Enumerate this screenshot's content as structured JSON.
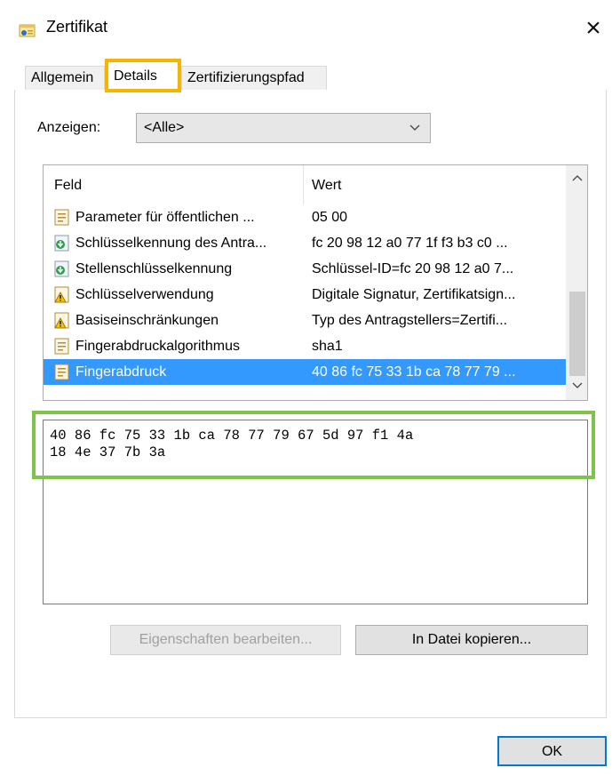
{
  "window": {
    "title": "Zertifikat",
    "close_glyph": "×"
  },
  "tabs": [
    {
      "label": "Allgemein",
      "active": false
    },
    {
      "label": "Details",
      "active": true
    },
    {
      "label": "Zertifizierungspfad",
      "active": false
    }
  ],
  "show": {
    "label": "Anzeigen:",
    "value": "<Alle>"
  },
  "list": {
    "columns": [
      "Feld",
      "Wert"
    ],
    "rows": [
      {
        "icon": "document-icon",
        "feld": "Parameter für öffentlichen ...",
        "wert": "05 00",
        "selected": false
      },
      {
        "icon": "key-download-icon",
        "feld": "Schlüsselkennung des Antra...",
        "wert": "fc 20 98 12 a0 77 1f f3 b3 c0 ...",
        "selected": false
      },
      {
        "icon": "key-download-icon",
        "feld": "Stellenschlüsselkennung",
        "wert": "Schlüssel-ID=fc 20 98 12 a0 7...",
        "selected": false
      },
      {
        "icon": "warning-document-icon",
        "feld": "Schlüsselverwendung",
        "wert": "Digitale Signatur, Zertifikatsign...",
        "selected": false
      },
      {
        "icon": "warning-document-icon",
        "feld": "Basiseinschränkungen",
        "wert": "Typ des Antragstellers=Zertifi...",
        "selected": false
      },
      {
        "icon": "document-icon",
        "feld": "Fingerabdruckalgorithmus",
        "wert": "sha1",
        "selected": false
      },
      {
        "icon": "document-icon",
        "feld": "Fingerabdruck",
        "wert": "40 86 fc 75 33 1b ca 78 77 79 ...",
        "selected": true
      }
    ]
  },
  "detail": {
    "line1": "40 86 fc 75 33 1b ca 78 77 79 67 5d 97 f1 4a",
    "line2": "18 4e 37 7b 3a"
  },
  "buttons": {
    "edit": "Eigenschaften bearbeiten...",
    "copy": "In Datei kopieren...",
    "ok": "OK"
  },
  "colors": {
    "tab_highlight": "#f5b400",
    "detail_highlight": "#7ec44b",
    "selection": "#3399ff",
    "ok_border": "#0078d7"
  }
}
